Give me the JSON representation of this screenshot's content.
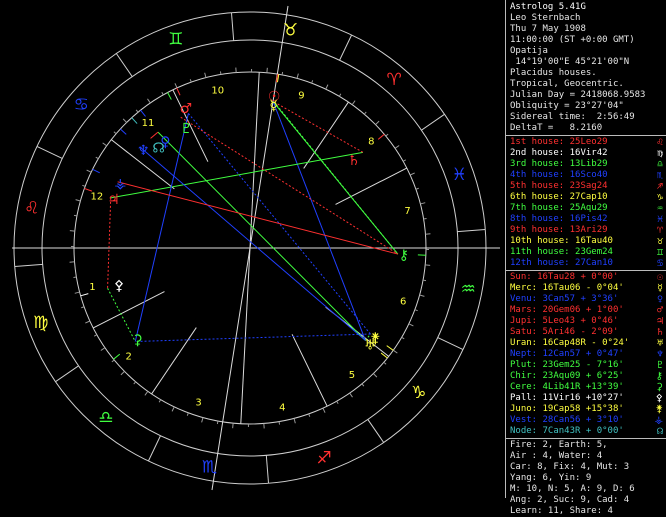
{
  "header": {
    "lines": [
      "Astrolog 5.41G",
      "Leo Sternbach",
      "Thu 7 May 1908",
      "11:00:00 (ST +0:00 GMT)",
      "Opatija",
      " 14°19'00\"E 45°21'00\"N",
      "Placidus houses.",
      "Tropical, Geocentric.",
      "Julian Day = 2418068.9583",
      "Obliquity = 23°27'04\"",
      "Sidereal time:  2:56:49",
      "DeltaT =   8.2160"
    ]
  },
  "houses": [
    {
      "text": "1st house: 25Leo29",
      "color": "#ff3030",
      "glyph": "♌"
    },
    {
      "text": "2nd house: 16Vir42",
      "color": "#ffffff",
      "glyph": "♍"
    },
    {
      "text": "3rd house: 13Lib29",
      "color": "#40ff40",
      "glyph": "♎"
    },
    {
      "text": "4th house: 16Sco40",
      "color": "#2040ff",
      "glyph": "♏"
    },
    {
      "text": "5th house: 23Sag24",
      "color": "#ff3030",
      "glyph": "♐"
    },
    {
      "text": "6th house: 27Cap10",
      "color": "#ffff40",
      "glyph": "♑"
    },
    {
      "text": "7th house: 25Aqu29",
      "color": "#40ff40",
      "glyph": "♒"
    },
    {
      "text": "8th house: 16Pis42",
      "color": "#2040ff",
      "glyph": "♓"
    },
    {
      "text": "9th house: 13Ari29",
      "color": "#ff3030",
      "glyph": "♈"
    },
    {
      "text": "10th house: 16Tau40",
      "color": "#ffff40",
      "glyph": "♉"
    },
    {
      "text": "11th house: 23Gem24",
      "color": "#40ff40",
      "glyph": "♊"
    },
    {
      "text": "12th house: 27Can10",
      "color": "#2040ff",
      "glyph": "♋"
    }
  ],
  "planets": [
    {
      "text": "Sun: 16Tau28 + 0°00'",
      "color": "#ff3030",
      "glyph": "☉"
    },
    {
      "text": "Merc: 16Tau06 - 0°04'",
      "color": "#ffff40",
      "glyph": "☿"
    },
    {
      "text": "Venu: 3Can57 + 3°36'",
      "color": "#2040ff",
      "glyph": "♀"
    },
    {
      "text": "Mars: 20Gem06 + 1°00'",
      "color": "#ff3030",
      "glyph": "♂"
    },
    {
      "text": "Jupi: 5Leo43 + 0°46'",
      "color": "#ff3030",
      "glyph": "♃"
    },
    {
      "text": "Satu: 5Ari46 - 2°09'",
      "color": "#ff3030",
      "glyph": "♄"
    },
    {
      "text": "Uran: 16Cap48R - 0°24'",
      "color": "#ffff40",
      "glyph": "♅"
    },
    {
      "text": "Nept: 12Can57 + 0°47'",
      "color": "#2040ff",
      "glyph": "♆"
    },
    {
      "text": "Plut: 23Gem25 - 7°16'",
      "color": "#40ff40",
      "glyph": "♇"
    },
    {
      "text": "Chir: 23Aqu09 + 6°25'",
      "color": "#40ff40",
      "glyph": "⚷"
    },
    {
      "text": "Cere: 4Lib41R +13°39'",
      "color": "#40ff40",
      "glyph": "⚳"
    },
    {
      "text": "Pall: 11Vir16 +10°27'",
      "color": "#ffffff",
      "glyph": "⚴"
    },
    {
      "text": "Juno: 19Cap58 +15°38'",
      "color": "#ffff40",
      "glyph": "⚵"
    },
    {
      "text": "Vest: 28Can56 + 3°10'",
      "color": "#2040ff",
      "glyph": "⚶"
    },
    {
      "text": "Node: 7Can43R + 0°00'",
      "color": "#40c0c0",
      "glyph": "☊"
    }
  ],
  "summary": [
    "Fire: 2, Earth: 5,",
    "Air : 4, Water: 4",
    "Car: 8, Fix: 4, Mut: 3",
    "Yang: 6, Yin: 9",
    "M: 10, N: 5, A: 9, D: 6",
    "Ang: 2, Suc: 9, Cad: 4",
    "Learn: 11, Share: 4"
  ],
  "wheel": {
    "signs": [
      "♈",
      "♉",
      "♊",
      "♋",
      "♌",
      "♍",
      "♎",
      "♏",
      "♐",
      "♑",
      "♒",
      "♓"
    ],
    "sign_colors": [
      "#ff3030",
      "#ffff40",
      "#40ff40",
      "#2040ff",
      "#ff3030",
      "#ffff40",
      "#40ff40",
      "#2040ff",
      "#ff3030",
      "#ffff40",
      "#40ff40",
      "#2040ff"
    ],
    "house_numbers": [
      "1",
      "2",
      "3",
      "4",
      "5",
      "6",
      "7",
      "8",
      "9",
      "10",
      "11",
      "12"
    ]
  }
}
